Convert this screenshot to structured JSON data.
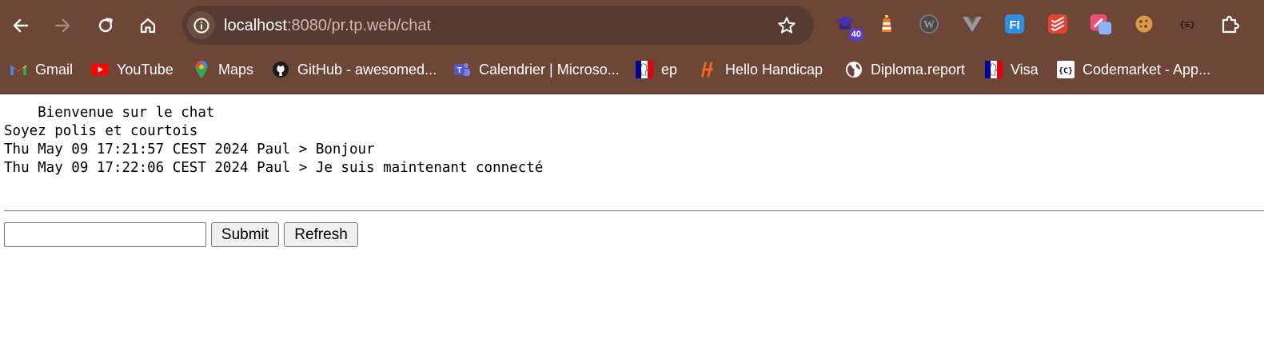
{
  "browser": {
    "url_host": "localhost",
    "url_rest": ":8080/pr.tp.web/chat",
    "extensions": [
      {
        "icon": "graduation-cap-icon",
        "badge": "40"
      },
      {
        "icon": "lighthouse-icon"
      },
      {
        "icon": "wordpress-icon"
      },
      {
        "icon": "vue-icon"
      },
      {
        "icon": "fi-icon",
        "text": "FI"
      },
      {
        "icon": "todoist-icon"
      },
      {
        "icon": "color-picker-icon"
      },
      {
        "icon": "cookie-icon"
      },
      {
        "icon": "json-icon",
        "text": "{≡}"
      },
      {
        "icon": "puzzle-icon"
      }
    ],
    "bookmarks": [
      {
        "label": "Gmail",
        "icon": "gmail-icon"
      },
      {
        "label": "YouTube",
        "icon": "youtube-icon"
      },
      {
        "label": "Maps",
        "icon": "maps-icon"
      },
      {
        "label": "GitHub - awesomed...",
        "icon": "github-icon"
      },
      {
        "label": "Calendrier | Microso...",
        "icon": "teams-icon"
      },
      {
        "label": "ep",
        "icon": "marianne-icon"
      },
      {
        "label": "Hello Handicap",
        "icon": "h-logo-icon"
      },
      {
        "label": "Diploma.report",
        "icon": "globe-icon"
      },
      {
        "label": "Visa",
        "icon": "marianne-icon"
      },
      {
        "label": "Codemarket - App...",
        "icon": "codemarket-icon",
        "text": "{C}"
      }
    ]
  },
  "chat": {
    "lines": [
      "    Bienvenue sur le chat",
      "Soyez polis et courtois",
      "Thu May 09 17:21:57 CEST 2024 Paul > Bonjour",
      "Thu May 09 17:22:06 CEST 2024 Paul > Je suis maintenant connecté"
    ]
  },
  "form": {
    "input_value": "",
    "submit_label": "Submit",
    "refresh_label": "Refresh"
  },
  "colors": {
    "chrome_bg": "#6e4638",
    "omnibox_bg": "#573a31"
  }
}
